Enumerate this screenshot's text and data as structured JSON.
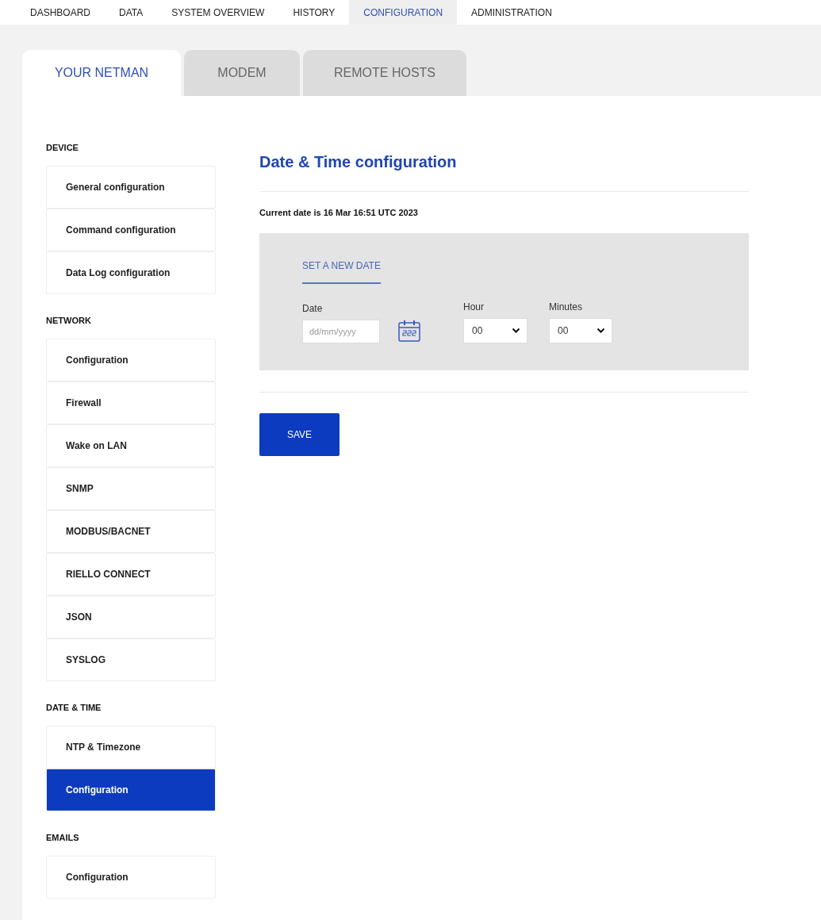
{
  "nav": [
    {
      "label": "DASHBOARD",
      "selected": false
    },
    {
      "label": "DATA",
      "selected": false
    },
    {
      "label": "SYSTEM OVERVIEW",
      "selected": false
    },
    {
      "label": "HISTORY",
      "selected": false
    },
    {
      "label": "CONFIGURATION",
      "selected": true
    },
    {
      "label": "ADMINISTRATION",
      "selected": false
    }
  ],
  "tabs": [
    {
      "label": "YOUR NETMAN",
      "selected": true
    },
    {
      "label": "MODEM",
      "selected": false
    },
    {
      "label": "REMOTE HOSTS",
      "selected": false
    }
  ],
  "sidebar": [
    {
      "heading": "DEVICE",
      "items": [
        {
          "label": "General configuration",
          "selected": false
        },
        {
          "label": "Command configuration",
          "selected": false
        },
        {
          "label": "Data Log configuration",
          "selected": false
        }
      ]
    },
    {
      "heading": "NETWORK",
      "items": [
        {
          "label": "Configuration",
          "selected": false
        },
        {
          "label": "Firewall",
          "selected": false
        },
        {
          "label": "Wake on LAN",
          "selected": false
        },
        {
          "label": "SNMP",
          "selected": false
        },
        {
          "label": "MODBUS/BACNET",
          "selected": false
        },
        {
          "label": "RIELLO CONNECT",
          "selected": false
        },
        {
          "label": "JSON",
          "selected": false
        },
        {
          "label": "SYSLOG",
          "selected": false
        }
      ]
    },
    {
      "heading": "DATE & TIME",
      "items": [
        {
          "label": "NTP & Timezone",
          "selected": false
        },
        {
          "label": "Configuration",
          "selected": true
        }
      ]
    },
    {
      "heading": "EMAILS",
      "items": [
        {
          "label": "Configuration",
          "selected": false
        }
      ]
    }
  ],
  "main": {
    "title": "Date & Time configuration",
    "current_date": "Current date is 16 Mar 16:51 UTC 2023",
    "section_title": "SET A NEW DATE",
    "date": {
      "label": "Date",
      "placeholder": "dd/mm/yyyy"
    },
    "hour": {
      "label": "Hour",
      "value": "00"
    },
    "minutes": {
      "label": "Minutes",
      "value": "00"
    },
    "save": "SAVE"
  }
}
